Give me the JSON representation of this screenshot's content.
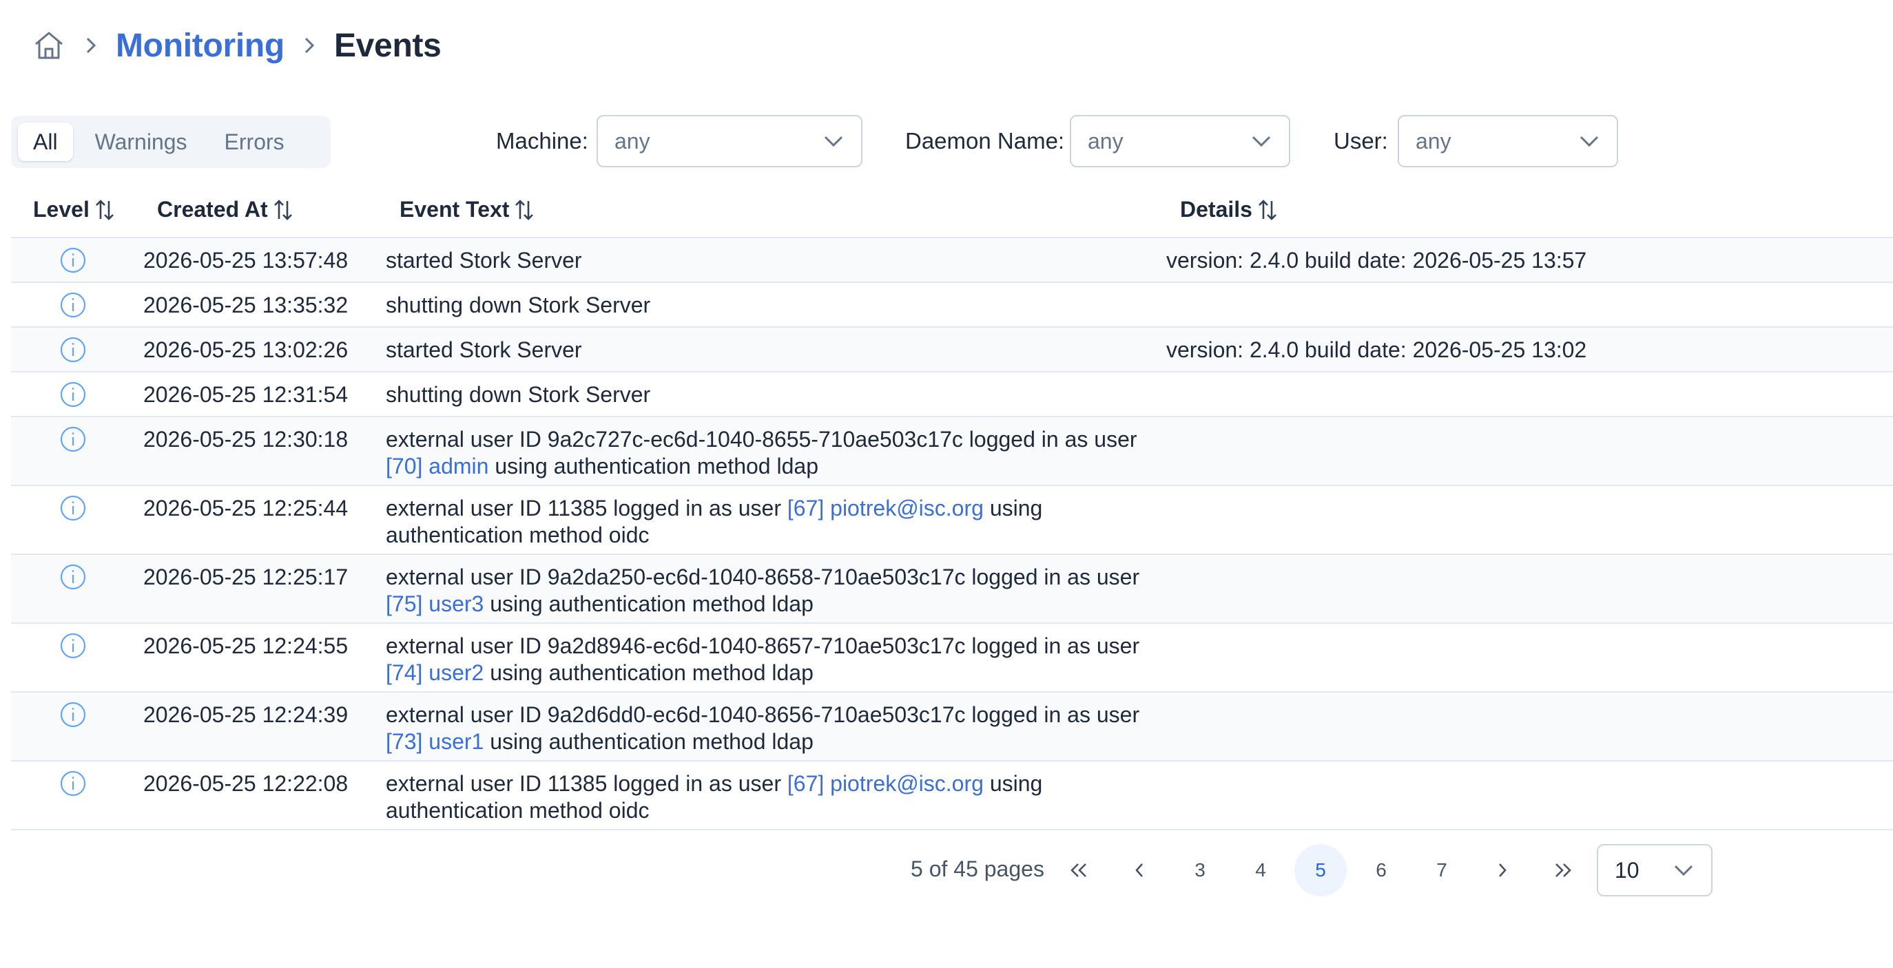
{
  "breadcrumb": {
    "items": [
      "Monitoring",
      "Events"
    ]
  },
  "level_tabs": [
    "All",
    "Warnings",
    "Errors"
  ],
  "filters": {
    "machine": {
      "label": "Machine:",
      "value": "any"
    },
    "daemon": {
      "label": "Daemon Name:",
      "value": "any"
    },
    "user": {
      "label": "User:",
      "value": "any"
    }
  },
  "table": {
    "headers": [
      "Level",
      "Created At",
      "Event Text",
      "Details"
    ],
    "rows": [
      {
        "created": "2026-05-25 13:57:48",
        "text_pre": "started Stork Server",
        "details": "version: 2.4.0 build date: 2026-05-25 13:57"
      },
      {
        "created": "2026-05-25 13:35:32",
        "text_pre": "shutting down Stork Server",
        "details": ""
      },
      {
        "created": "2026-05-25 13:02:26",
        "text_pre": "started Stork Server",
        "details": "version: 2.4.0 build date: 2026-05-25 13:02"
      },
      {
        "created": "2026-05-25 12:31:54",
        "text_pre": "shutting down Stork Server",
        "details": ""
      },
      {
        "created": "2026-05-25 12:30:18",
        "text_pre": "external user ID 9a2c727c-ec6d-1040-8655-710ae503c17c logged in as user ",
        "link": "[70] admin",
        "text_post": " using authentication method ldap",
        "details": ""
      },
      {
        "created": "2026-05-25 12:25:44",
        "text_pre": "external user ID 11385 logged in as user ",
        "link": "[67] piotrek@isc.org",
        "text_post": " using authentication method oidc",
        "details": ""
      },
      {
        "created": "2026-05-25 12:25:17",
        "text_pre": "external user ID 9a2da250-ec6d-1040-8658-710ae503c17c logged in as user ",
        "link": "[75] user3",
        "text_post": " using authentication method ldap",
        "details": ""
      },
      {
        "created": "2026-05-25 12:24:55",
        "text_pre": "external user ID 9a2d8946-ec6d-1040-8657-710ae503c17c logged in as user ",
        "link": "[74] user2",
        "text_post": " using authentication method ldap",
        "details": ""
      },
      {
        "created": "2026-05-25 12:24:39",
        "text_pre": "external user ID 9a2d6dd0-ec6d-1040-8656-710ae503c17c logged in as user ",
        "link": "[73] user1",
        "text_post": " using authentication method ldap",
        "details": ""
      },
      {
        "created": "2026-05-25 12:22:08",
        "text_pre": "external user ID 11385 logged in as user ",
        "link": "[67] piotrek@isc.org",
        "text_post": " using authentication method oidc",
        "details": ""
      }
    ]
  },
  "paginator": {
    "info": "5 of 45 pages",
    "pages": [
      "3",
      "4",
      "5",
      "6",
      "7"
    ],
    "current": "5",
    "rows_per_page": "10"
  },
  "colors": {
    "accent": "#2563eb",
    "link": "#3b6fd8",
    "text": "#1e293b"
  }
}
